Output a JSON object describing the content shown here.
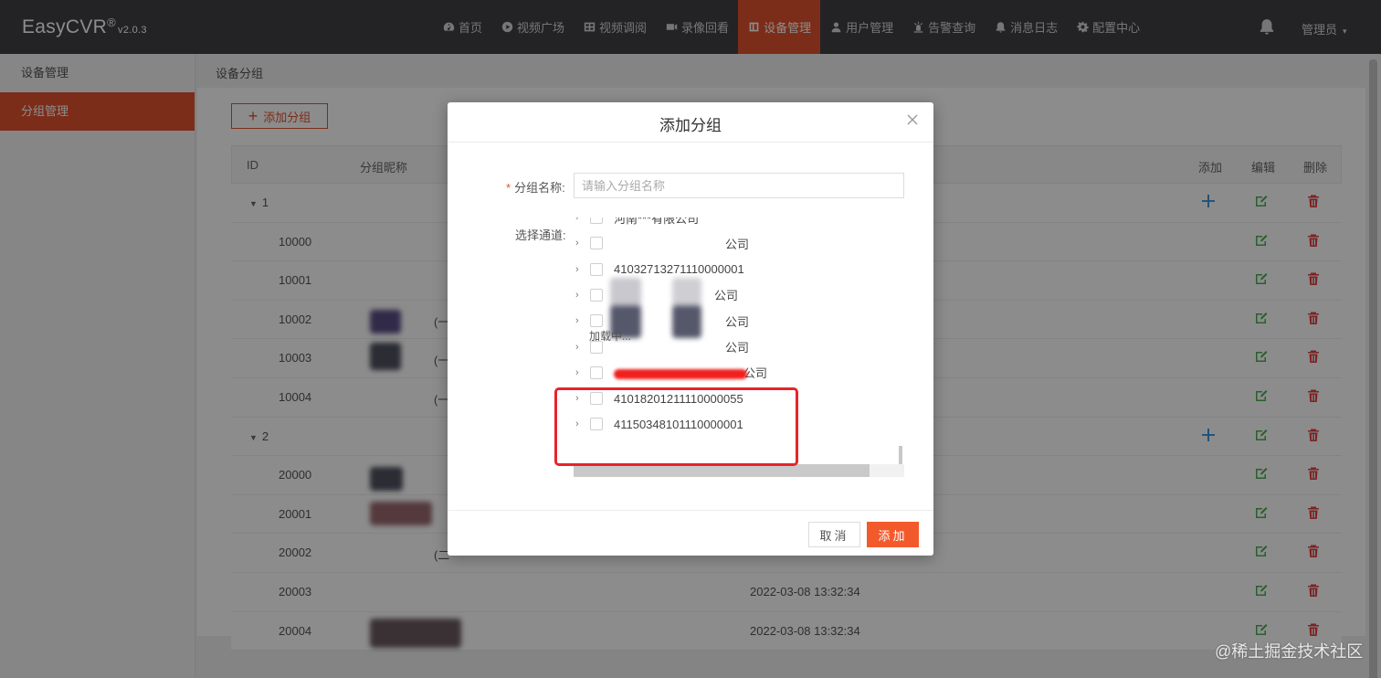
{
  "app": {
    "name": "EasyCVR",
    "reg": "®",
    "version": "v2.0.3"
  },
  "nav": {
    "items": [
      {
        "label": "首页",
        "icon": "dashboard-icon"
      },
      {
        "label": "视频广场",
        "icon": "play-circle-icon"
      },
      {
        "label": "视频调阅",
        "icon": "grid-icon"
      },
      {
        "label": "录像回看",
        "icon": "video-camera-icon"
      },
      {
        "label": "设备管理",
        "icon": "device-icon",
        "active": true
      },
      {
        "label": "用户管理",
        "icon": "user-icon"
      },
      {
        "label": "告警查询",
        "icon": "alarm-icon"
      },
      {
        "label": "消息日志",
        "icon": "bell-icon"
      },
      {
        "label": "配置中心",
        "icon": "gear-icon"
      }
    ],
    "admin_label": "管理员"
  },
  "sidebar": {
    "items": [
      {
        "label": "设备管理",
        "active": false
      },
      {
        "label": "分组管理",
        "active": true
      }
    ]
  },
  "breadcrumb": "设备分组",
  "add_group_button": "添加分组",
  "table": {
    "headers": {
      "id": "ID",
      "name": "分组昵称",
      "add": "添加",
      "edit": "编辑",
      "delete": "删除"
    },
    "rows": [
      {
        "id": "1",
        "group": true,
        "name": "",
        "time": ""
      },
      {
        "id": "10000",
        "name": "",
        "time": ""
      },
      {
        "id": "10001",
        "name": "",
        "time": ""
      },
      {
        "id": "10002",
        "name": "(一",
        "time": ""
      },
      {
        "id": "10003",
        "name": "(一",
        "time": ""
      },
      {
        "id": "10004",
        "name": "(一",
        "time": ""
      },
      {
        "id": "2",
        "group": true,
        "name": "",
        "time": ""
      },
      {
        "id": "20000",
        "name": "",
        "time": ""
      },
      {
        "id": "20001",
        "name": "",
        "time": ""
      },
      {
        "id": "20002",
        "name": "(二",
        "time": ""
      },
      {
        "id": "20003",
        "name": "",
        "time": "2022-03-08 13:32:34"
      },
      {
        "id": "20004",
        "name": "",
        "time": "2022-03-08 13:32:34"
      }
    ]
  },
  "modal": {
    "title": "添加分组",
    "name_label": "分组名称:",
    "name_placeholder": "请输入分组名称",
    "name_value": "",
    "channel_label": "选择通道:",
    "tree": [
      {
        "label": "河南***有限公司"
      },
      {
        "label": "公司"
      },
      {
        "label": "41032713271110000001"
      },
      {
        "label": "公司"
      },
      {
        "label": "公司"
      },
      {
        "label": "公司"
      },
      {
        "label": "公司"
      },
      {
        "label": "41018201211110000055"
      },
      {
        "label": "41150348101110000001"
      }
    ],
    "loading": "加载中...",
    "cancel": "取消",
    "add": "添加"
  },
  "watermark": "@稀土掘金技术社区",
  "colors": {
    "accent": "#e0532f",
    "topbar": "#404044",
    "annotation": "#e8242a"
  }
}
